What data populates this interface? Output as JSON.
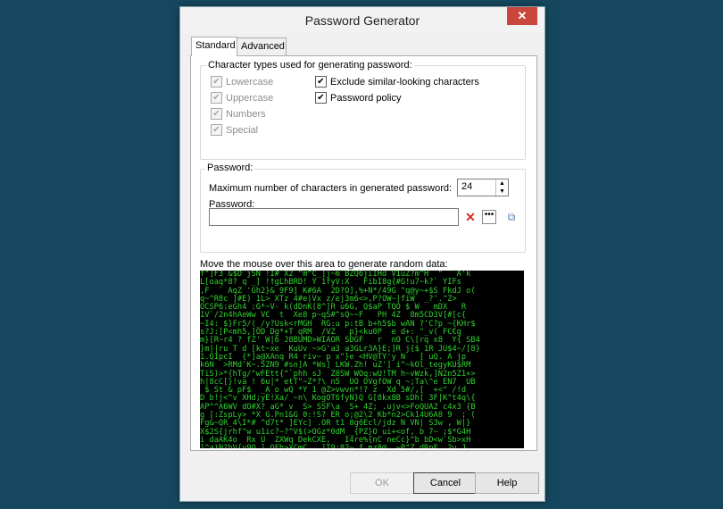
{
  "window": {
    "title": "Password Generator",
    "close_symbol": "✕"
  },
  "tabs": [
    {
      "label": "Standard",
      "active": true
    },
    {
      "label": "Advanced",
      "active": false
    }
  ],
  "char_types": {
    "legend": "Character types used for generating password:",
    "options": [
      {
        "label": "Lowercase",
        "checked": true,
        "enabled": false
      },
      {
        "label": "Uppercase",
        "checked": true,
        "enabled": false
      },
      {
        "label": "Numbers",
        "checked": true,
        "enabled": false
      },
      {
        "label": "Special",
        "checked": true,
        "enabled": false
      }
    ],
    "extra": [
      {
        "label": "Exclude similar-looking characters",
        "checked": true,
        "enabled": true
      },
      {
        "label": "Password policy",
        "checked": true,
        "enabled": true
      }
    ]
  },
  "password_group": {
    "legend": "Password:",
    "max_len_label": "Maximum number of characters in generated password:",
    "max_len_value": "24",
    "password_label": "Password:",
    "password_value": ""
  },
  "entropy": {
    "label": "Move the mouse over this area to generate random data:",
    "lines": [
      "f\"]F3 &$D jSN !I# X2 \"m^C_]j~m`BZQ6jiIHd V1uZ?m^H  \" ` A'k",
      "L[oaq*8? q _] !†gLhBRD! Y 1fyV:X   FibI8g{#G!u7~k?` YIFs",
      ",F  ` AqZ 'Gh2}& 9F9] K#6A  2D?O],%+N*/49G \"q@y~+$S FkdJ o(",
      "q~^R8c ]#E) 1L> XTz 4#e|Vx z/ej3m6<>,P?OW~|fiW  _?'.\"Z>",
      "OCSP6:eGh4 :G*~V- k(dDnK(8^]R u6G, Q$aP TQO $ W   mDX   R",
      "1V`/2n4hAeWw VC  t  Xe8 p~qS#^sQ~~F   PH 4Z  8m5CD3V[#[c{",
      "~I4: $}Fr5/(_/y?Usk<rMGH  RG:u p:tB b+h5$b wAN ?'C?p ~{KHr$",
      "s?J:[P<mh5,]OD Dg*+T qRM  /VZ   p}<ku0P  e d+: \"_v( FC€g",
      "m}[R~r4 ? fZ' W|6 J8BUMD>WIAOR SDGF   r  nO C\\[rq x8  Y{ SB4",
      "}m||ru T d [kt~xe  KuUv ~>G'a3 a3GLr3A}E;]R j{$ 1R JU$4~/[8}",
      "1.QIpcI  {*]a@XAnq R4 riv~ p x\"}e <HV@TY'y N   [ uQ. A jp",
      "k6N  >RMd'K~.5ZN9 #sn]A *Ws] LKW.Zh! uZ'] i^~kOl_tegyKU$RM",
      "TiS)>*{hTg/\"wFEtt{^`phh sJ  Z8SW WOq:wU!TM h~vWzk,]N2n5Z1+>",
      "h|8cC[}!va ! 6u|* etT\"~Z*?\\ n5  UO OVgfOW q ~;Ta\\^e EN7  UB",
      " $ St & pF$  _A o wQ *Y 1 @Z>vwvn*!? z  Xd 5#/,[  +<\" /!d",
      "D b!j<^v XHd;yE!Xa/ ~n\\ KogOT6fyN}Q G[8kx8B sDh( 3F|K\"t4q\\{",
      "AP^^A6WV dO#X? aG* v  S> SSF\\a  S+ 4Z; .ujv<>FoQUA2 c4x3 {B",
      "g [:ZspLy> *X G.Pn1&G 0:!S? ER o;@2\\2 Kb*n2>Ck14U6A8 9  ; (",
      "Fg&~QR_4\\I*# ^d7t* ]EYc] .OR t1 8g6Ecl/jdz N VN| S3w , W|}",
      "X$2S{jrhf\"w u1ic?~?^V$(>OGz*0dM _{PZ}O ui+<of, b 7~ ;$*G4H",
      "i daAK4o  Rx U  ZXWq DekCXE,   I4re%{nC neCc}^b bD<w`Sb>xH",
      "]^a)N?bV{y9Q ] QFh>XCmC   ]T9;82~ f mz8@  ~P\"Z dRpF, 2u J",
      "6RZh'Zxo 5   E5OK J#5A uN#{];J=D3\\ EXS N~^Z 1#l ^K B ]  q4"
    ]
  },
  "buttons": {
    "ok": "OK",
    "cancel": "Cancel",
    "help": "Help"
  }
}
